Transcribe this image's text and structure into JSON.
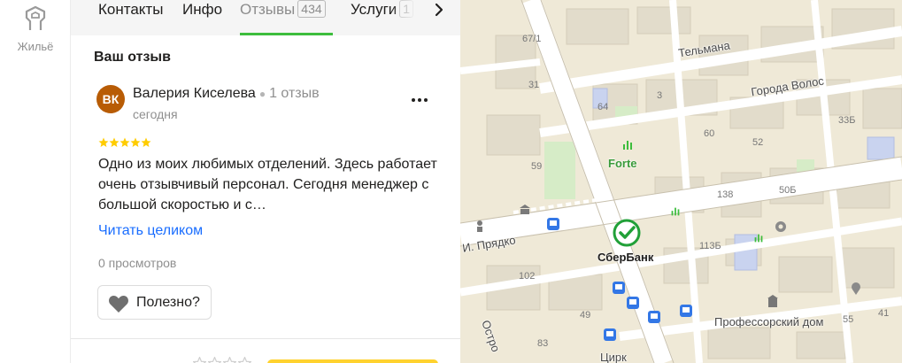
{
  "rail": {
    "items": [
      {
        "label": "Жильё",
        "icon": "hand-house-icon"
      }
    ]
  },
  "tabs": [
    {
      "label": "Контакты"
    },
    {
      "label": "Инфо"
    },
    {
      "label": "Отзывы",
      "badge": "434",
      "active": true
    },
    {
      "label": "Услуги",
      "badge": "1"
    }
  ],
  "review_section": {
    "title": "Ваш отзыв"
  },
  "review": {
    "avatar_initials": "ВК",
    "avatar_color": "#b85c05",
    "author": "Валерия Киселева",
    "author_reviews": "1 отзыв",
    "date": "сегодня",
    "rating": 5,
    "text": "Одно из моих любимых отделений. Здесь работает очень отзывчивый персонал. Сегодня менеджер с большой скоростью и с…",
    "read_more": "Читать целиком",
    "views": "0 просмотров",
    "useful_label": "Полезно?"
  },
  "colors": {
    "accent_green": "#3dbd3d",
    "link_blue": "#196dff",
    "star": "#fc0",
    "sber_green": "#21a038"
  },
  "map": {
    "streets": [
      "Тельмана",
      "Города Волос",
      "И. Прядко",
      "Остро"
    ],
    "pois": [
      "Forte",
      "СберБанк",
      "Профессорский дом",
      "Цирк"
    ],
    "house_numbers": [
      "67/1",
      "31",
      "64",
      "3",
      "59",
      "60",
      "52",
      "138",
      "50Б",
      "33Б",
      "113Б",
      "102",
      "49",
      "83",
      "55",
      "41"
    ]
  }
}
